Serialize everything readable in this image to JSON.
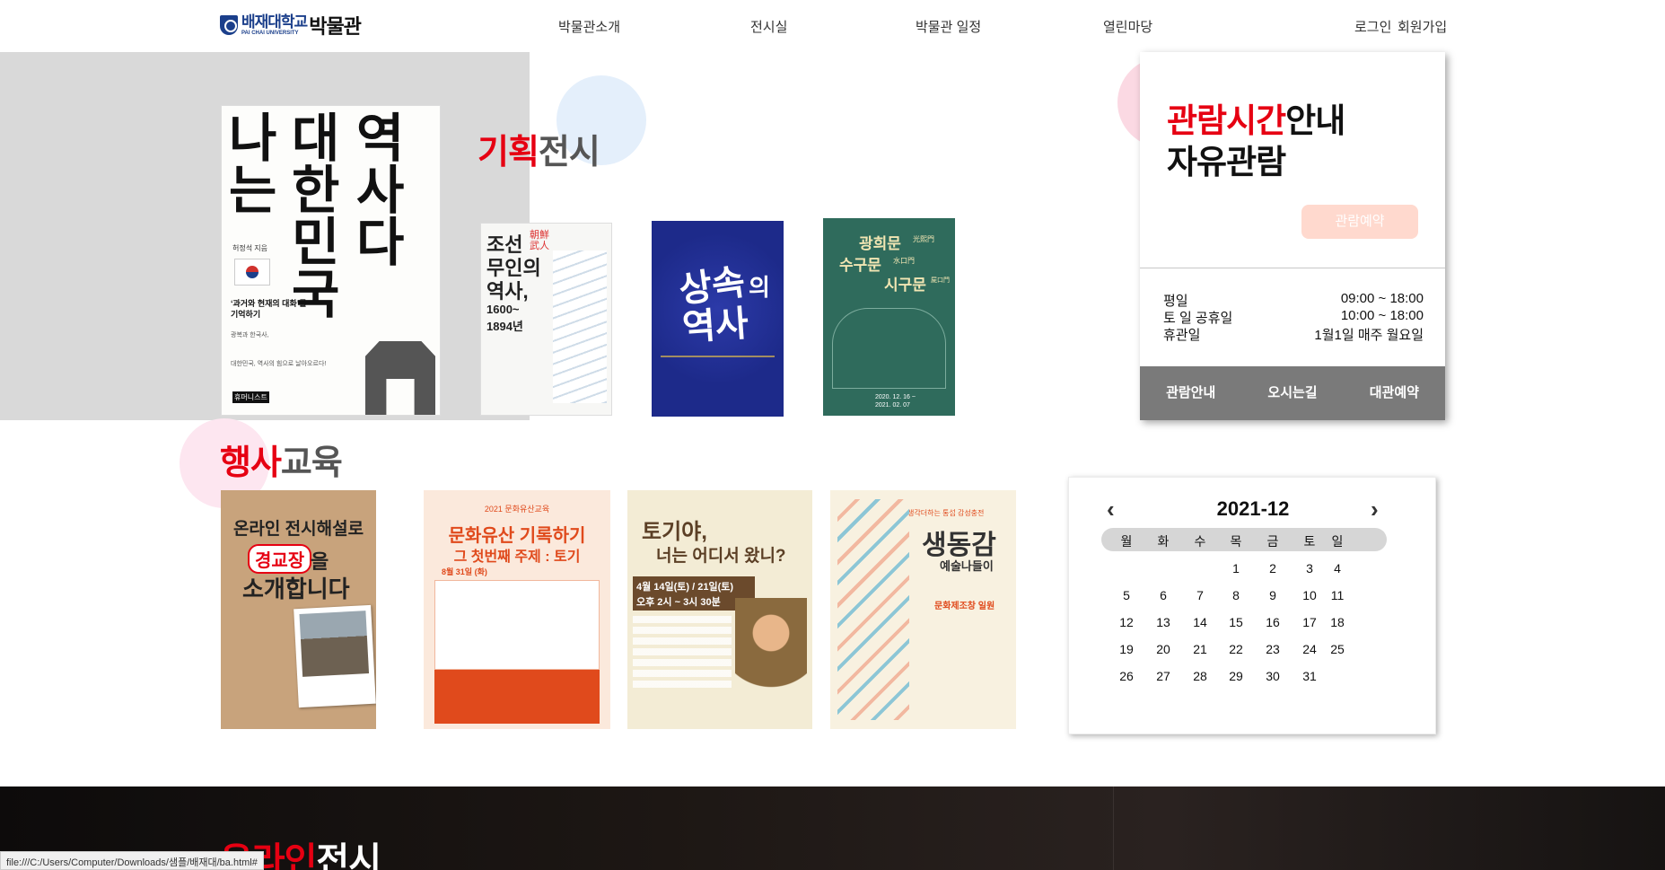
{
  "header": {
    "logo_univ_ko": "배재대학교",
    "logo_univ_en": "PAI CHAI UNIVERSITY",
    "logo_museum": "박물관",
    "nav": [
      "박물관소개",
      "전시실",
      "박물관 일정",
      "열린마당",
      "로그인",
      "회원가입"
    ]
  },
  "exhibition": {
    "title_red": "기획",
    "title_gray": "전시",
    "main_book": {
      "title_chars": [
        "역",
        "대",
        "나",
        "사",
        "한",
        "는",
        "다",
        "민",
        "국"
      ],
      "author": "허정석 지음",
      "subtitle": "‘과거와 현재의 대화’를 기억하기",
      "desc1": "광복과 한국사,",
      "desc2": "대한민국, 역사의 힘으로 날아오르다!",
      "publisher": "휴머니스트"
    },
    "book2": {
      "line1": "조선",
      "line1b": "朝鮮",
      "line1c": "武人",
      "line2": "무인의",
      "line3": "역사,",
      "line4": "1600~",
      "line5": "1894년"
    },
    "book3": {
      "title_a": "상속",
      "title_b": "의",
      "title_c": "역사"
    },
    "book4": {
      "line1": "광희문",
      "line1_small": "光熙門",
      "line2": "수구문",
      "line2_small": "水口門",
      "line3": "시구문",
      "line3_small": "屍口門",
      "date1": "2020. 12. 16 ~",
      "date2": "2021. 02. 07"
    }
  },
  "info": {
    "title_red": "관람시간",
    "title_black": "안내",
    "subtitle": "자유관람",
    "reserve_label": "관람예약",
    "hours": [
      {
        "label": "평일",
        "value": "09:00 ~ 18:00"
      },
      {
        "label": "토 일 공휴일",
        "value": "10:00 ~ 18:00"
      },
      {
        "label": "휴관일",
        "value": "1월1일 매주 월요일"
      }
    ],
    "tabs": [
      "관람안내",
      "오시는길",
      "대관예약"
    ]
  },
  "events": {
    "title_red": "행사",
    "title_gray": "교육",
    "poster1": {
      "line1": "온라인 전시해설로",
      "highlight": "경교장",
      "line2a": "을",
      "line2b": "소개합니다"
    },
    "poster2": {
      "top": "2021 문화유산교육",
      "line1": "문화유산 기록하기",
      "line2": "그 첫번째 주제 : 토기",
      "date": "8월 31일 (화)"
    },
    "poster3": {
      "line1": "토기야,",
      "line2": "너는 어디서 왔니?",
      "date1": "4월 14일(토) / 21일(토)",
      "date2": "오후 2시 ~ 3시 30분"
    },
    "poster4": {
      "head": "생각더하는 통섭 감성충전",
      "title": "생동감",
      "sub": "예술나들이",
      "place": "문화제조창 일원"
    }
  },
  "calendar": {
    "month_label": "2021-12",
    "weekdays": [
      "월",
      "화",
      "수",
      "목",
      "금",
      "토",
      "일"
    ],
    "weeks": [
      [
        "",
        "",
        "",
        "1",
        "2",
        "3",
        "4"
      ],
      [
        "5",
        "6",
        "7",
        "8",
        "9",
        "10",
        "11"
      ],
      [
        "12",
        "13",
        "14",
        "15",
        "16",
        "17",
        "18"
      ],
      [
        "19",
        "20",
        "21",
        "22",
        "23",
        "24",
        "25"
      ],
      [
        "26",
        "27",
        "28",
        "29",
        "30",
        "31",
        ""
      ]
    ],
    "prev_icon": "chevron-left-icon",
    "next_icon": "chevron-right-icon"
  },
  "online": {
    "title_red": "온라인",
    "title_white": "전시"
  },
  "status_bar": {
    "url": "file:///C:/Users/Computer/Downloads/샘플/배재대/ba.html#"
  },
  "colors": {
    "accent_red": "#e60012",
    "brand_blue": "#1b3f8b",
    "reserve_button": "#ffd9ce",
    "tab_bar": "#7a7a7a"
  }
}
